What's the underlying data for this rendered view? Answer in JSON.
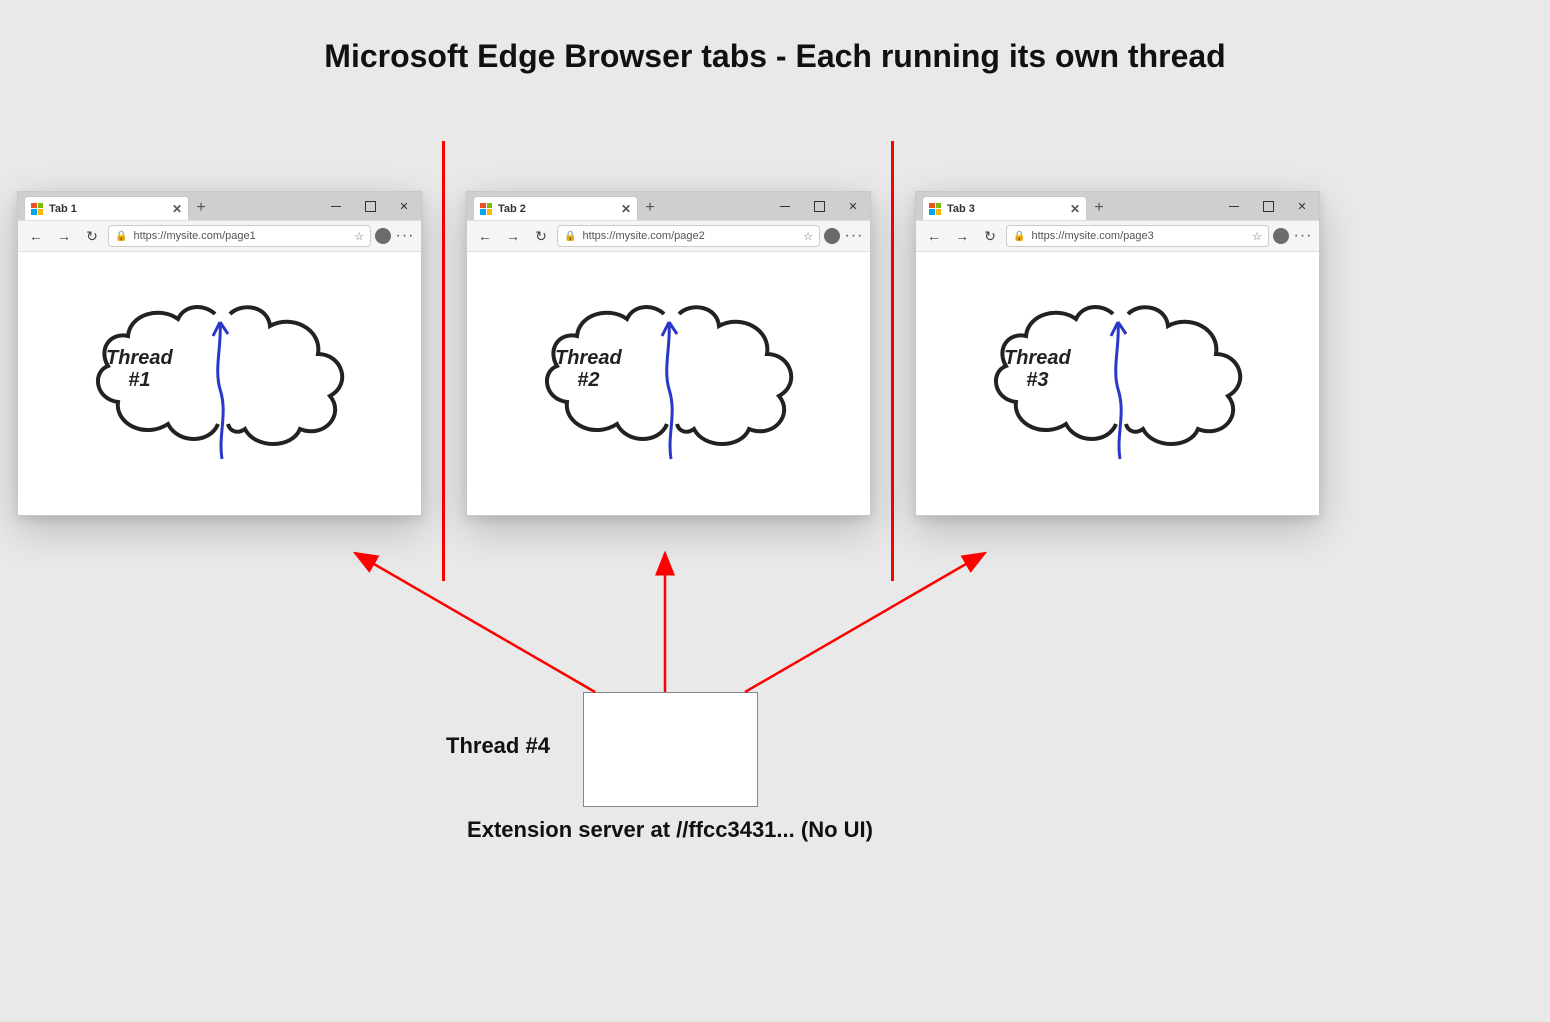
{
  "title": "Microsoft Edge Browser tabs - Each running its own thread",
  "browsers": [
    {
      "tab_label": "Tab 1",
      "url": "https://mysite.com/page1",
      "thread_line1": "Thread",
      "thread_line2": "#1"
    },
    {
      "tab_label": "Tab 2",
      "url": "https://mysite.com/page2",
      "thread_line1": "Thread",
      "thread_line2": "#2"
    },
    {
      "tab_label": "Tab 3",
      "url": "https://mysite.com/page3",
      "thread_line1": "Thread",
      "thread_line2": "#3"
    }
  ],
  "extension": {
    "thread_label": "Thread #4",
    "caption": "Extension server at //ffcc3431... (No UI)"
  }
}
